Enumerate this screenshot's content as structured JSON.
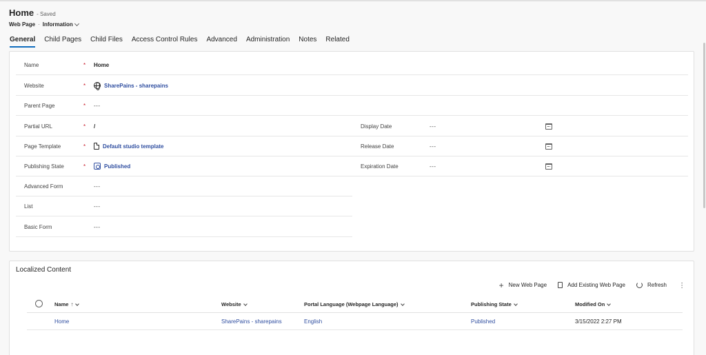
{
  "header": {
    "title": "Home",
    "status": "- Saved",
    "entity": "Web Page",
    "separator": "·",
    "form_name": "Information"
  },
  "tabs": [
    {
      "label": "General",
      "active": true
    },
    {
      "label": "Child Pages"
    },
    {
      "label": "Child Files"
    },
    {
      "label": "Access Control Rules"
    },
    {
      "label": "Advanced"
    },
    {
      "label": "Administration"
    },
    {
      "label": "Notes"
    },
    {
      "label": "Related"
    }
  ],
  "form": {
    "required_mark": "*",
    "name": {
      "label": "Name",
      "value": "Home"
    },
    "website": {
      "label": "Website",
      "value": "SharePains - sharepains"
    },
    "parent_page": {
      "label": "Parent Page",
      "value": "---"
    },
    "partial_url": {
      "label": "Partial URL",
      "value": "/"
    },
    "page_template": {
      "label": "Page Template",
      "value": "Default studio template"
    },
    "publishing_state": {
      "label": "Publishing State",
      "value": "Published"
    },
    "advanced_form": {
      "label": "Advanced Form",
      "value": "---"
    },
    "list": {
      "label": "List",
      "value": "---"
    },
    "basic_form": {
      "label": "Basic Form",
      "value": "---"
    },
    "display_date": {
      "label": "Display Date",
      "value": "---"
    },
    "release_date": {
      "label": "Release Date",
      "value": "---"
    },
    "expiration_date": {
      "label": "Expiration Date",
      "value": "---"
    }
  },
  "localized": {
    "title": "Localized Content",
    "commands": {
      "new": "New Web Page",
      "add_existing": "Add Existing Web Page",
      "refresh": "Refresh"
    },
    "columns": {
      "name": "Name",
      "website": "Website",
      "language": "Portal Language (Webpage Language)",
      "state": "Publishing State",
      "modified": "Modified On"
    },
    "sort_arrow": "↑",
    "rows": [
      {
        "name": "Home",
        "website": "SharePains - sharepains",
        "language": "English",
        "state": "Published",
        "modified": "3/15/2022 2:27 PM"
      }
    ]
  }
}
